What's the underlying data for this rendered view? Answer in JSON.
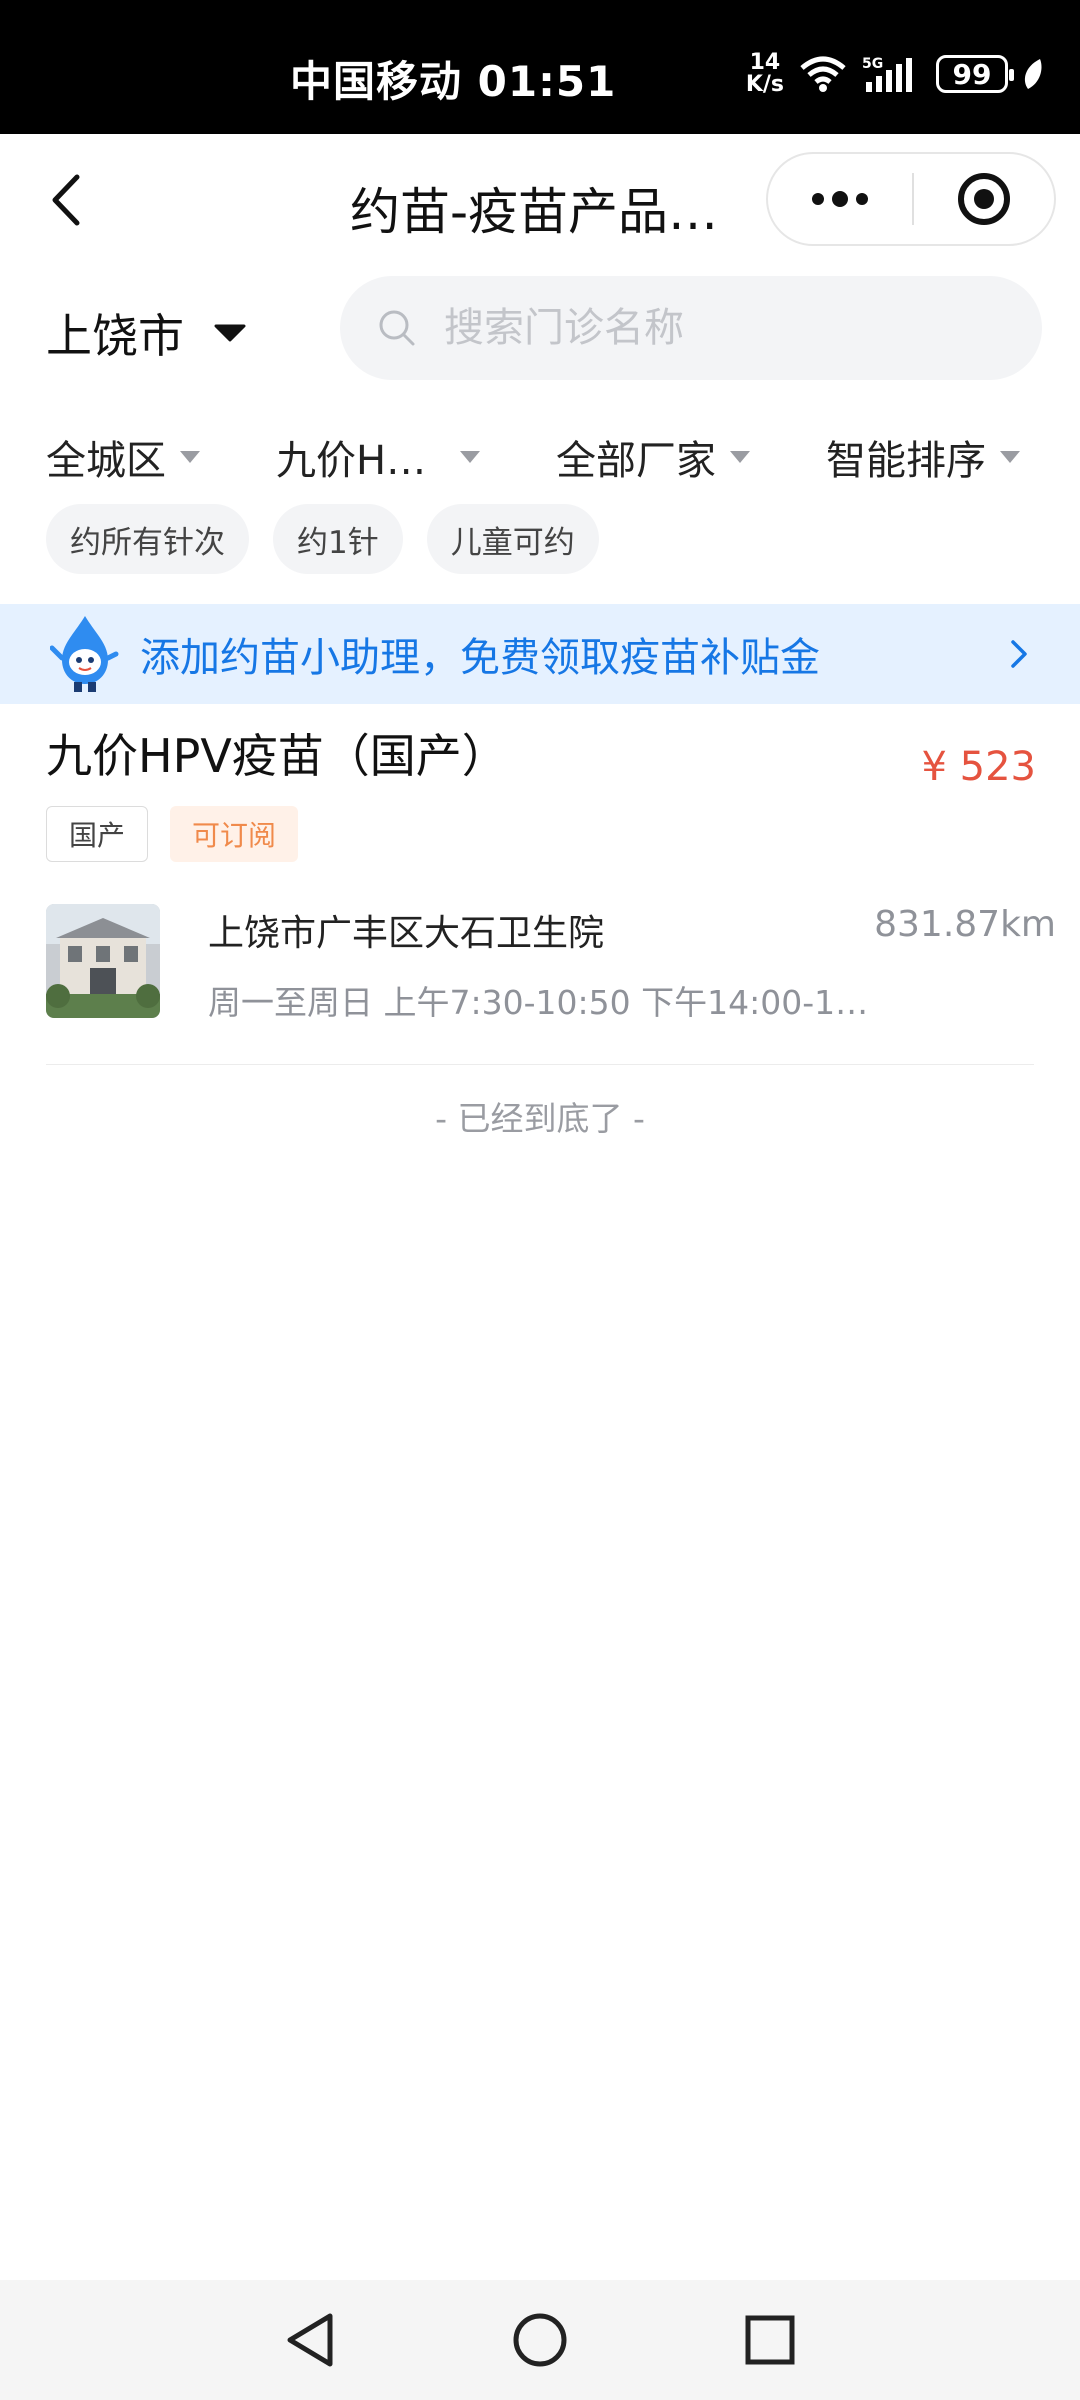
{
  "status_bar": {
    "carrier_time": "中国移动 01:51",
    "net_speed_value": "14",
    "net_speed_unit": "K/s",
    "battery": "99",
    "icons": [
      "wifi-icon",
      "signal-5g-icon",
      "battery-icon",
      "leaf-icon"
    ]
  },
  "nav": {
    "title": "约苗-疫苗产品…",
    "back_icon": "back-chevron-icon",
    "more_icon": "more-dots-icon",
    "close_icon": "target-close-icon"
  },
  "location": {
    "city": "上饶市",
    "search_placeholder": "搜索门诊名称"
  },
  "filters": [
    {
      "label": "全城区"
    },
    {
      "label": "九价H…"
    },
    {
      "label": "全部厂家"
    },
    {
      "label": "智能排序"
    }
  ],
  "chips": [
    "约所有针次",
    "约1针",
    "儿童可约"
  ],
  "banner": {
    "text": "添加约苗小助理，免费领取疫苗补贴金"
  },
  "product": {
    "title": "九价HPV疫苗（国产）",
    "price": "¥ 523",
    "tags": [
      "国产",
      "可订阅"
    ],
    "clinic": {
      "name": "上饶市广丰区大石卫生院",
      "distance": "831.87km",
      "hours": "周一至周日 上午7:30-10:50 下午14:00-1…"
    }
  },
  "footer_text": "- 已经到底了 -",
  "colors": {
    "accent_blue": "#1677e5",
    "price_red": "#e5533f",
    "tag_orange": "#f08a4b",
    "banner_bg": "#e5f1ff"
  }
}
